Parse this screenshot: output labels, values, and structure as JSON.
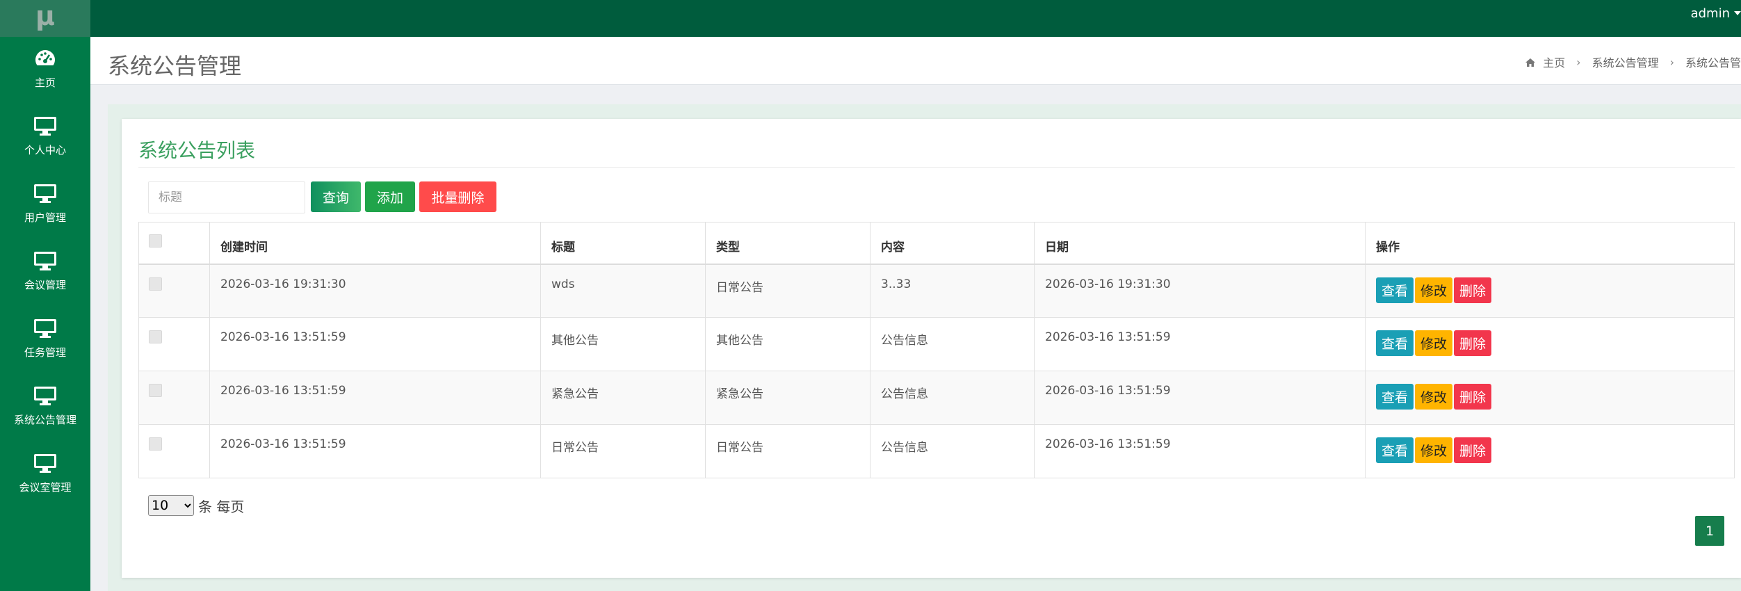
{
  "header": {
    "logo": "μ",
    "user": "admin"
  },
  "sidebar": {
    "items": [
      {
        "label": "主页",
        "icon": "dashboard-icon"
      },
      {
        "label": "个人中心",
        "icon": "monitor-icon"
      },
      {
        "label": "用户管理",
        "icon": "monitor-icon"
      },
      {
        "label": "会议管理",
        "icon": "monitor-icon"
      },
      {
        "label": "任务管理",
        "icon": "monitor-icon"
      },
      {
        "label": "系统公告管理",
        "icon": "monitor-icon"
      },
      {
        "label": "会议室管理",
        "icon": "monitor-icon"
      }
    ]
  },
  "page": {
    "title": "系统公告管理",
    "breadcrumb": {
      "home": "主页",
      "level1": "系统公告管理",
      "level2": "系统公告管"
    }
  },
  "card": {
    "title": "系统公告列表"
  },
  "toolbar": {
    "search_placeholder": "标题",
    "query_label": "查询",
    "add_label": "添加",
    "batch_delete_label": "批量删除"
  },
  "table": {
    "columns": [
      "创建时间",
      "标题",
      "类型",
      "内容",
      "日期",
      "操作"
    ],
    "rows": [
      {
        "created": "2026-03-16 19:31:30",
        "title": "wds",
        "type": "日常公告",
        "content": "3..33",
        "date": "2026-03-16 19:31:30"
      },
      {
        "created": "2026-03-16 13:51:59",
        "title": "其他公告",
        "type": "其他公告",
        "content": "公告信息",
        "date": "2026-03-16 13:51:59"
      },
      {
        "created": "2026-03-16 13:51:59",
        "title": "紧急公告",
        "type": "紧急公告",
        "content": "公告信息",
        "date": "2026-03-16 13:51:59"
      },
      {
        "created": "2026-03-16 13:51:59",
        "title": "日常公告",
        "type": "日常公告",
        "content": "公告信息",
        "date": "2026-03-16 13:51:59"
      }
    ],
    "actions": {
      "view": "查看",
      "edit": "修改",
      "delete": "删除"
    }
  },
  "pagination": {
    "page_size": "10",
    "page_size_suffix": "条 每页",
    "current_page": "1"
  },
  "colors": {
    "topbar": "#005c3d",
    "sidebar": "#007a48",
    "card_title": "#3ca060",
    "view_button": "#1a9fb5",
    "edit_button": "#ffb400",
    "delete_button": "#f2364c"
  }
}
